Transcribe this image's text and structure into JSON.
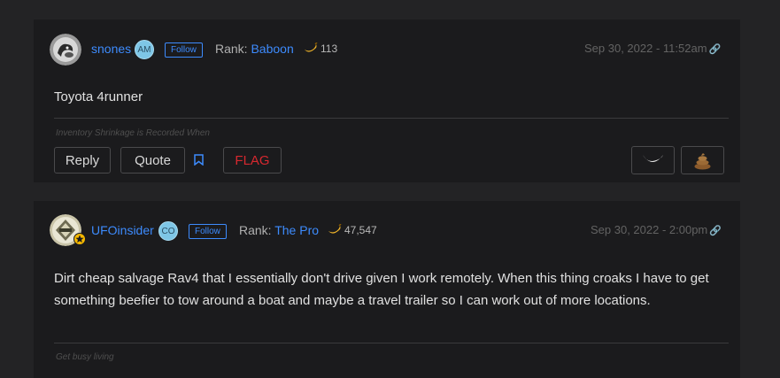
{
  "posts": [
    {
      "username": "snones",
      "initials": "AM",
      "follow_label": "Follow",
      "rank_label": "Rank:",
      "rank_value": "Baboon",
      "bananas": "113",
      "timestamp": "Sep 30, 2022 - 11:52am",
      "content": "Toyota 4runner",
      "signature": "Inventory Shrinkage is Recorded When",
      "actions": {
        "reply": "Reply",
        "quote": "Quote",
        "flag": "FLAG"
      },
      "avatar_icon": "monkey-avatar-icon"
    },
    {
      "username": "UFOinsider",
      "initials": "CO",
      "follow_label": "Follow",
      "rank_label": "Rank:",
      "rank_value": "The Pro",
      "bananas": "47,547",
      "timestamp": "Sep 30, 2022 - 2:00pm",
      "content": "Dirt cheap salvage Rav4 that I essentially don't drive given I work remotely.  When this thing croaks I have to get something beefier to tow around a boat and maybe a travel trailer so I can work out of more locations.",
      "signature": "Get busy living",
      "avatar_icon": "badge-avatar-icon"
    }
  ],
  "colors": {
    "link": "#3d8bfd",
    "flag": "#d7282f",
    "background": "#232325",
    "card": "#1b1b1d"
  }
}
